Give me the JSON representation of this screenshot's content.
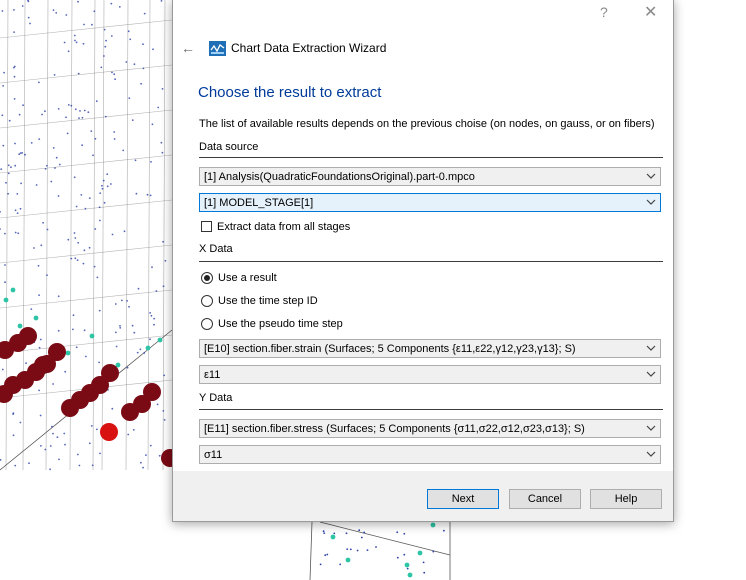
{
  "dialog": {
    "title": "Chart Data Extraction Wizard",
    "help_glyph": "?",
    "close_glyph": "✕",
    "back_glyph": "←",
    "heading": "Choose the result to extract",
    "description": "The list of available results depends on the previous choise (on nodes, on gauss, or on fibers)"
  },
  "data_source": {
    "label": "Data source",
    "analysis": "[1] Analysis(QuadraticFoundationsOriginal).part-0.mpco",
    "stage": "[1] MODEL_STAGE[1]",
    "extract_all_label": "Extract data from all stages",
    "extract_all_checked": false
  },
  "x_data": {
    "label": "X Data",
    "options": [
      "Use a result",
      "Use the time step ID",
      "Use the pseudo time step"
    ],
    "selected_index": 0,
    "result": "[E10] section.fiber.strain (Surfaces; 5 Components {ε11,ε22,γ12,γ23,γ13}; S)",
    "component": "ε11"
  },
  "y_data": {
    "label": "Y Data",
    "result": "[E11] section.fiber.stress (Surfaces; 5 Components {σ11,σ22,σ12,σ23,σ13}; S)",
    "component": "σ11"
  },
  "buttons": {
    "next": "Next",
    "cancel": "Cancel",
    "help": "Help"
  },
  "icons": {
    "wizard": "chart-wizard-icon",
    "back": "back-arrow-icon",
    "help": "help-icon",
    "close": "close-icon"
  },
  "colors": {
    "heading": "#003b9a",
    "accent": "#0078d7",
    "node_dark": "#7a0a14",
    "node_red": "#d81111",
    "node_teal": "#2ec4a6",
    "grid": "#777777"
  }
}
